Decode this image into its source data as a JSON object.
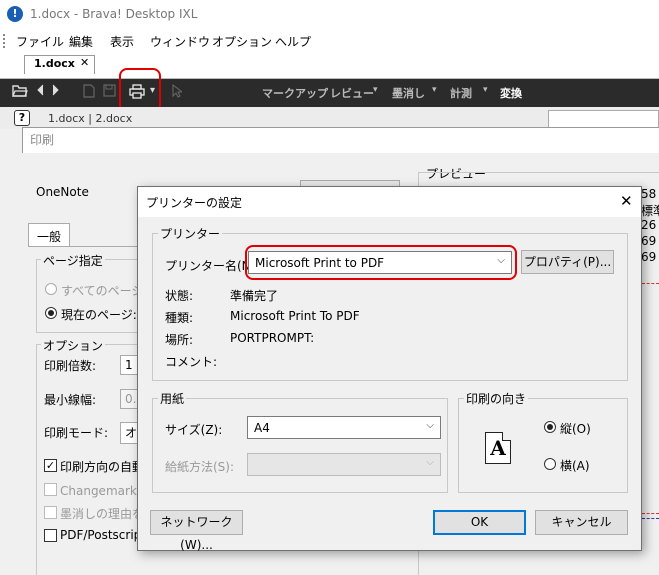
{
  "window": {
    "app_icon": "!",
    "title": "1.docx - Brava! Desktop IXL"
  },
  "menu": [
    "ファイル",
    "編集",
    "表示",
    "ウィンドウ",
    "オプション",
    "ヘルプ"
  ],
  "document_tab": {
    "label": "1.docx",
    "close": "✕"
  },
  "toolbar": {
    "icons": [
      "folder-open-icon",
      "arrow-left-icon",
      "arrow-right-icon",
      "new-page-icon",
      "save-icon",
      "print-icon",
      "cursor-icon"
    ],
    "labels": {
      "markup": "マークアップ",
      "review": "レビュー",
      "redact": "墨消し",
      "measure": "計測",
      "transform": "変換"
    },
    "dropdown_glyph": "▾"
  },
  "subbar": {
    "help": "?",
    "doc_tabs": "1.docx | 2.docx"
  },
  "print_dialog": {
    "title": "印刷",
    "printer_label": "OneNote",
    "preview_label": "プレビュー",
    "preview_numbers": [
      "58",
      "26",
      "69",
      "69"
    ],
    "preview_text": "標準",
    "tab_general": "一般",
    "page_group": {
      "title": "ページ指定",
      "all_pages": "すべてのページ",
      "current_page": "現在のページ:",
      "current_selected": true
    },
    "options_group": {
      "title": "オプション",
      "print_scale_label": "印刷倍数:",
      "print_scale_value": "1",
      "min_line_width_label": "最小線幅:",
      "min_line_width_value": "0.",
      "print_mode_label": "印刷モード:",
      "print_mode_value": "オリ",
      "auto_orient_label": "印刷方向の自動",
      "auto_orient_checked": true,
      "changemark_label": "Changemarkを",
      "redact_reason_label": "墨消しの理由を",
      "pdf_postscript_label": "PDF/Postscript"
    }
  },
  "printer_setup": {
    "title": "プリンターの設定",
    "close": "✕",
    "printer_group": {
      "title": "プリンター",
      "name_label": "プリンター名(N):",
      "name_value": "Microsoft Print to PDF",
      "properties_button": "プロパティ(P)...",
      "status_label": "状態:",
      "status_value": "準備完了",
      "type_label": "種類:",
      "type_value": "Microsoft Print To PDF",
      "location_label": "場所:",
      "location_value": "PORTPROMPT:",
      "comment_label": "コメント:",
      "comment_value": ""
    },
    "paper_group": {
      "title": "用紙",
      "size_label": "サイズ(Z):",
      "size_value": "A4",
      "source_label": "給紙方法(S):",
      "source_value": ""
    },
    "orientation_group": {
      "title": "印刷の向き",
      "portrait": "縦(O)",
      "landscape": "横(A)",
      "portrait_selected": true,
      "page_glyph": "A"
    },
    "network_button": "ネットワーク(W)...",
    "ok_button": "OK",
    "cancel_button": "キャンセル"
  },
  "colors": {
    "highlight": "#e00000",
    "toolbar_bg": "#2b2b2b",
    "accent": "#0078d7"
  }
}
